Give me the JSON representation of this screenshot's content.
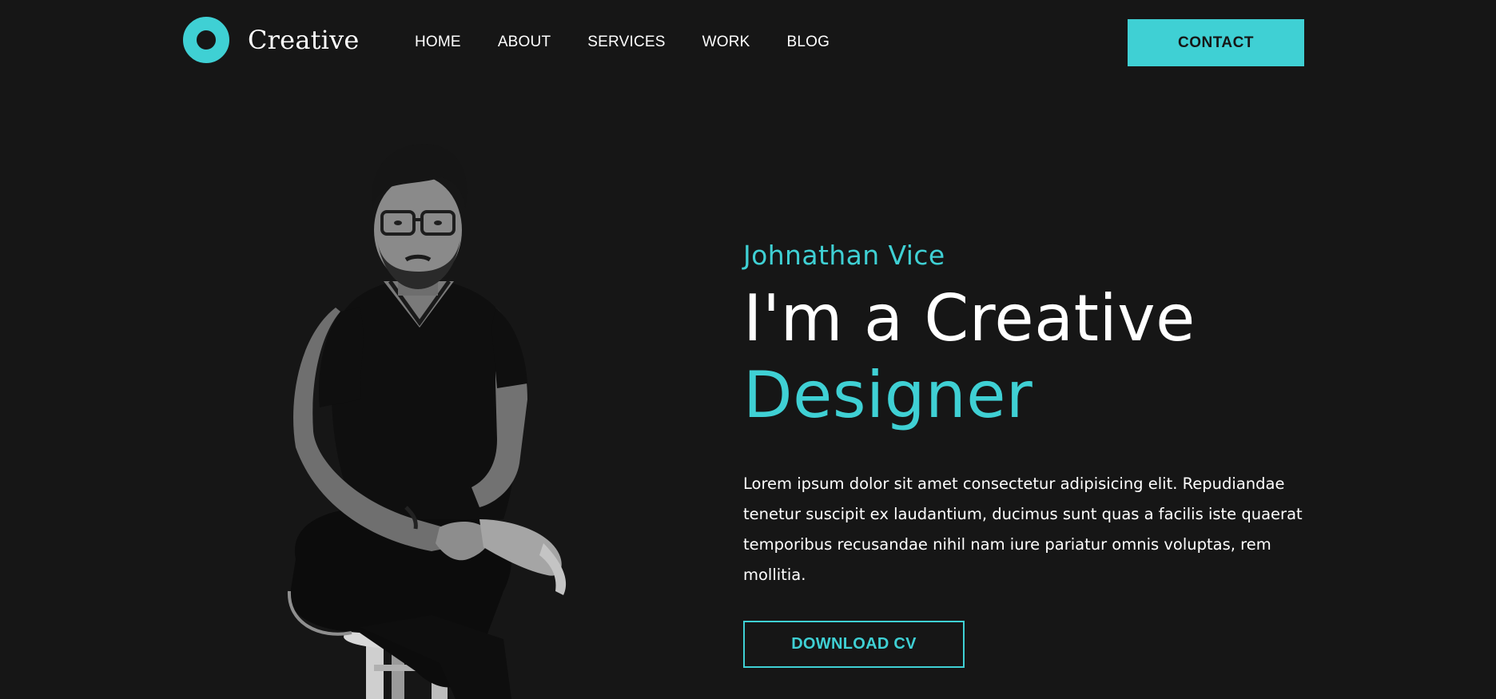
{
  "brand": {
    "name": "Creative",
    "accent_color": "#3fd0d4",
    "background": "#161616"
  },
  "nav": {
    "items": [
      {
        "label": "HOME"
      },
      {
        "label": "ABOUT"
      },
      {
        "label": "SERVICES"
      },
      {
        "label": "WORK"
      },
      {
        "label": "BLOG"
      }
    ],
    "contact_label": "CONTACT"
  },
  "hero": {
    "name": "Johnathan Vice",
    "title_line1": "I'm a Creative",
    "title_line2": "Designer",
    "description": "Lorem ipsum dolor sit amet consectetur adipisicing elit. Repudiandae tenetur suscipit ex laudantium, ducimus sunt quas a facilis iste quaerat temporibus recusandae nihil nam iure pariatur omnis voluptas, rem mollitia.",
    "download_label": "DOWNLOAD CV",
    "photo": "portrait-photo"
  }
}
